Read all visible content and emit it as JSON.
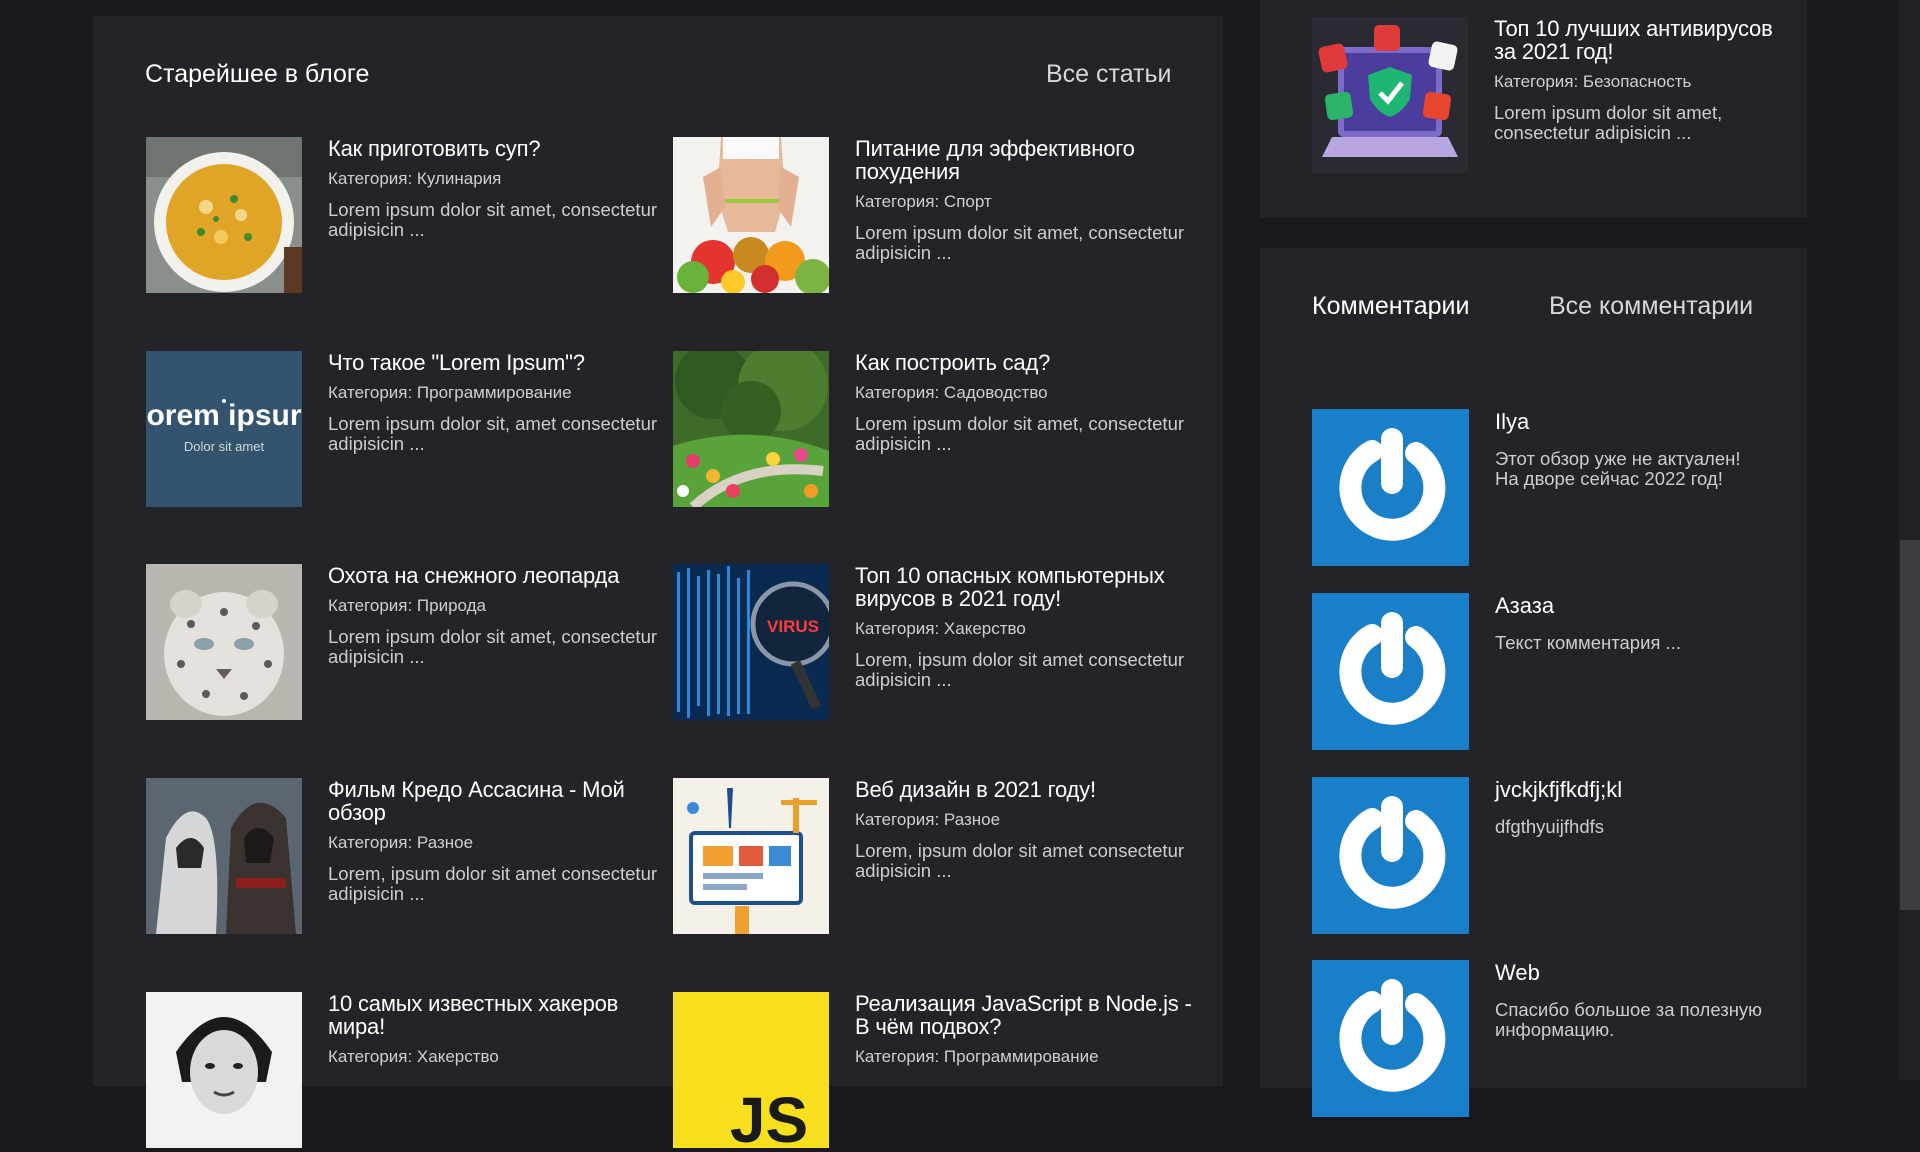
{
  "blog": {
    "title": "Старейшее в блоге",
    "all_link": "Все статьи",
    "articles": [
      {
        "title": "Как приготовить суп?",
        "category": "Категория: Кулинария",
        "excerpt": "Lorem ipsum dolor sit amet, consectetur adipisicin ..."
      },
      {
        "title": "Питание для эффективного похудения",
        "category": "Категория: Спорт",
        "excerpt": "Lorem ipsum dolor sit amet, consectetur adipisicin ..."
      },
      {
        "title": "Что такое \"Lorem Ipsum\"?",
        "category": "Категория: Программирование",
        "excerpt": "Lorem ipsum dolor sit, amet consectetur adipisicin ...",
        "thumb_text": "orem ipsur",
        "thumb_sub": "Dolor sit amet"
      },
      {
        "title": "Как построить сад?",
        "category": "Категория: Садоводство",
        "excerpt": "Lorem ipsum dolor sit amet, consectetur adipisicin ..."
      },
      {
        "title": "Охота на снежного леопарда",
        "category": "Категория: Природа",
        "excerpt": "Lorem ipsum dolor sit amet, consectetur adipisicin ..."
      },
      {
        "title": "Топ 10 опасных компьютерных вирусов в 2021 году!",
        "category": "Категория: Хакерство",
        "excerpt": "Lorem, ipsum dolor sit amet consectetur adipisicin ...",
        "thumb_text": "VIRUS"
      },
      {
        "title": "Фильм Кредо Ассасина - Мой обзор",
        "category": "Категория: Разное",
        "excerpt": "Lorem, ipsum dolor sit amet consectetur adipisicin ..."
      },
      {
        "title": "Веб дизайн в 2021 году!",
        "category": "Категория: Разное",
        "excerpt": "Lorem, ipsum dolor sit amet consectetur adipisicin ..."
      },
      {
        "title": "10 самых известных хакеров мира!",
        "category": "Категория: Хакерство",
        "excerpt": ""
      },
      {
        "title": "Реализация JavaScript в Node.js - В чём подвох?",
        "category": "Категория: Программирование",
        "excerpt": "",
        "thumb_text": "JS"
      }
    ]
  },
  "sidebar_top": {
    "title": "Топ 10 лучших антивирусов за 2021 год!",
    "category": "Категория: Безопасность",
    "excerpt": "Lorem ipsum dolor sit amet, consectetur adipisicin ..."
  },
  "comments": {
    "title": "Комментарии",
    "all_link": "Все комментарии",
    "items": [
      {
        "name": "Ilya",
        "text": "Этот обзор уже не актуален! На дворе сейчас 2022 год!"
      },
      {
        "name": "Азаза",
        "text": "Текст комментария ..."
      },
      {
        "name": "jvckjkfjfkdfj;kl",
        "text": "dfgthyuijfhdfs"
      },
      {
        "name": "Web",
        "text": "Спасибо большое за полезную информацию."
      }
    ]
  },
  "colors": {
    "background": "#17191c",
    "panel": "#222427",
    "avatar_blue": "#1a7fc9"
  }
}
